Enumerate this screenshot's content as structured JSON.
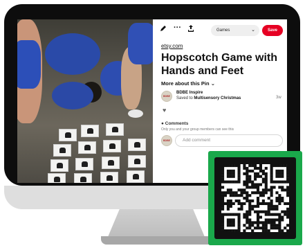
{
  "toolbar": {
    "edit_icon": "pencil-icon",
    "more_icon": "ellipsis-icon",
    "share_icon": "share-upload-icon",
    "board_select_value": "Games",
    "save_label": "Save",
    "save_color": "#e60023"
  },
  "pin": {
    "source_link": "etsy.com",
    "title": "Hopscotch Game with Hands and Feet",
    "more_about_label": "More about this Pin",
    "saver": {
      "avatar_text": "BDBE",
      "name": "BDBE Inspire",
      "saved_prefix": "Saved to",
      "board": "Multisensory Christmas",
      "time": "3w"
    },
    "comments": {
      "heading": "Comments",
      "note": "Only you and your group members can see this",
      "input_placeholder": "Add comment"
    }
  },
  "colors": {
    "badge_green": "#1aa84b",
    "monitor_bezel": "#0d0d0d",
    "monitor_chin": "#dedede"
  }
}
